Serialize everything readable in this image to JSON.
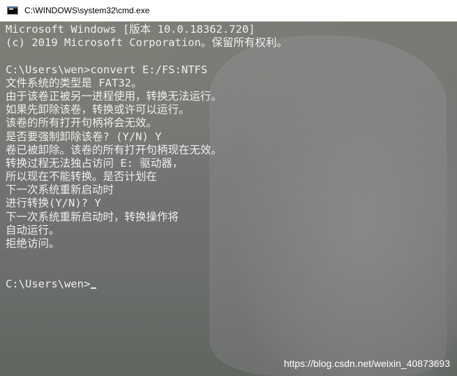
{
  "window": {
    "title": "C:\\WINDOWS\\system32\\cmd.exe",
    "icon": "cmd-icon"
  },
  "console": {
    "lines": [
      "Microsoft Windows [版本 10.0.18362.720]",
      "(c) 2019 Microsoft Corporation。保留所有权利。",
      "",
      "C:\\Users\\wen>convert E:/FS:NTFS",
      "文件系统的类型是 FAT32。",
      "由于该卷正被另一进程使用，转换无法运行。",
      "如果先卸除该卷，转换或许可以运行。",
      "该卷的所有打开句柄将会无效。",
      "是否要强制卸除该卷? (Y/N) Y",
      "卷已被卸除。该卷的所有打开句柄现在无效。",
      "转换过程无法独占访问 E: 驱动器，",
      "所以现在不能转换。是否计划在",
      "下一次系统重新启动时",
      "进行转换(Y/N)? Y",
      "下一次系统重新启动时，转换操作将",
      "自动运行。",
      "拒绝访问。",
      "",
      "",
      "C:\\Users\\wen>"
    ]
  },
  "watermark": "https://blog.csdn.net/weixin_40873693"
}
